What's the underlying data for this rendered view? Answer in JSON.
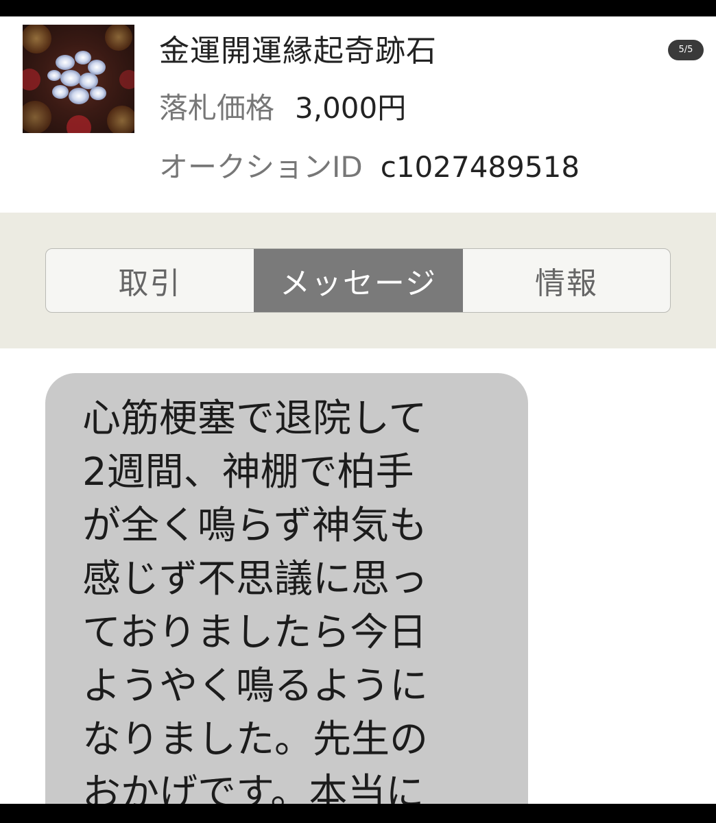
{
  "item": {
    "title": "金運開運縁起奇跡石",
    "page_indicator": "5/5",
    "price_label": "落札価格",
    "price_value": "3,000円",
    "id_label": "オークションID",
    "id_value": "c1027489518",
    "thumbnail_icon": "gemstone-photo"
  },
  "tabs": [
    {
      "label": "取引",
      "selected": false
    },
    {
      "label": "メッセージ",
      "selected": true
    },
    {
      "label": "情報",
      "selected": false
    }
  ],
  "message": {
    "lines": [
      "心筋梗塞で退院して",
      "2週間、神棚で柏手",
      "が全く鳴らず神気も",
      "感じず不思議に思っ",
      "ておりましたら今日",
      "ようやく鳴るように",
      "なりました。先生の",
      "おかげです。本当に"
    ]
  },
  "colors": {
    "tab_selected_bg": "#7a7a7a",
    "tab_area_bg": "#ecebe2",
    "bubble_bg": "#c9c9c9",
    "badge_bg": "#3a3a3a"
  }
}
